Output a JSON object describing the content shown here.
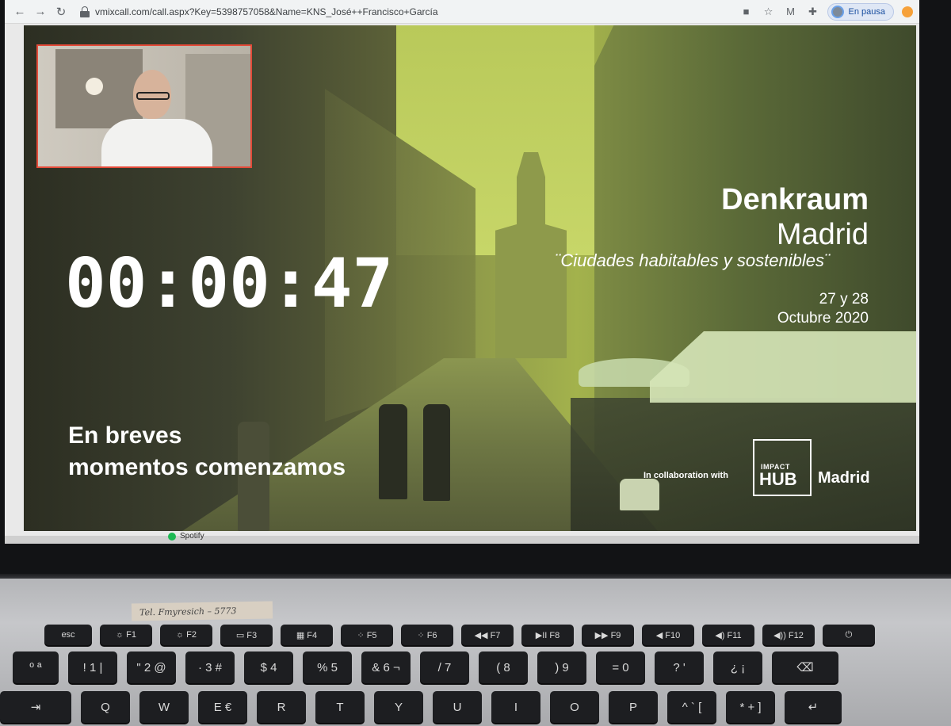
{
  "browser": {
    "url": "vmixcall.com/call.aspx?Key=5398757058&Name=KNS_José++Francisco+García",
    "profile_label": "En pausa",
    "back_glyph": "←",
    "forward_glyph": "→",
    "reload_glyph": "↻"
  },
  "slide": {
    "timer": [
      "00",
      ":",
      "00",
      ":",
      "47"
    ],
    "breves_line1": "En breves",
    "breves_line2": "momentos comenzamos",
    "title_line1": "Denkraum",
    "title_line2": "Madrid",
    "subtitle": "¨Ciudades habitables y sostenibles¨",
    "date_line1": "27 y 28",
    "date_line2": "Octubre 2020",
    "collab_text": "In collaboration with",
    "hub_impact": "IMPACT",
    "hub_hub": "HUB",
    "hub_city": "Madrid"
  },
  "taskbar": {
    "spotify_label": "Spotify"
  },
  "sticky_note": "Tel. Fmyresich – 5773",
  "keyboard": {
    "function_row": [
      "esc",
      "☼ F1",
      "☼ F2",
      "▭ F3",
      "▦ F4",
      "⁘ F5",
      "⁘ F6",
      "◀◀ F7",
      "▶II F8",
      "▶▶ F9",
      "◀ F10",
      "◀) F11",
      "◀)) F12",
      "⏻"
    ],
    "number_row": [
      "º ª",
      "! 1 |",
      "\" 2 @",
      "· 3 #",
      "$ 4",
      "% 5",
      "& 6 ¬",
      "/ 7",
      "( 8",
      ") 9",
      "= 0",
      "? '",
      "¿ ¡",
      "⌫"
    ],
    "letter_row": [
      "⇥",
      "Q",
      "W",
      "E €",
      "R",
      "T",
      "Y",
      "U",
      "I",
      "O",
      "P",
      "^ ` [",
      "* + ]",
      "↵"
    ]
  },
  "colors": {
    "webcam_border": "#e44b39",
    "slide_tint": "#a3b24c",
    "key_color": "#1d1e21"
  }
}
